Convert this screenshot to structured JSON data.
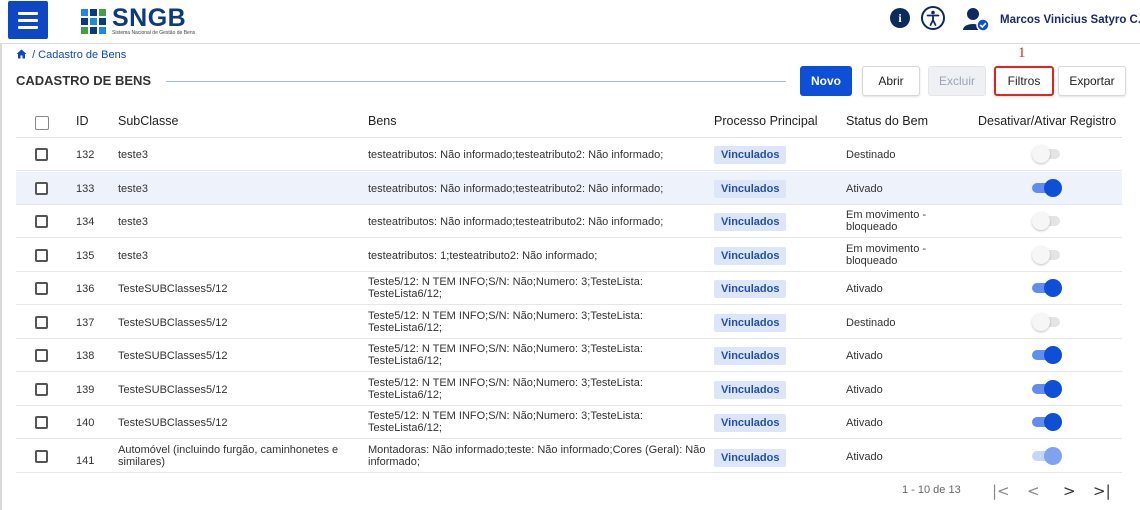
{
  "app": {
    "logo_text": "SNGB",
    "logo_subtitle": "Sistema Nacional de Gestão de Bens",
    "user_name": "Marcos Vinicius Satyro C..."
  },
  "breadcrumb": {
    "text": "/ Cadastro de Bens"
  },
  "page": {
    "title": "CADASTRO DE BENS"
  },
  "toolbar": {
    "novo": "Novo",
    "abrir": "Abrir",
    "excluir": "Excluir",
    "filtros": "Filtros",
    "exportar": "Exportar",
    "marker": "1"
  },
  "table": {
    "headers": {
      "id": "ID",
      "subclasse": "SubClasse",
      "bens": "Bens",
      "processo": "Processo Principal",
      "status": "Status do Bem",
      "toggle": "Desativar/Ativar Registro"
    },
    "rows": [
      {
        "id": "132",
        "subclasse": "teste3",
        "bens": "testeatributos: Não informado;testeatributo2: Não informado;",
        "processo": "Vinculados",
        "status": "Destinado",
        "active": false
      },
      {
        "id": "133",
        "subclasse": "teste3",
        "bens": "testeatributos: Não informado;testeatributo2: Não informado;",
        "processo": "Vinculados",
        "status": "Ativado",
        "active": true
      },
      {
        "id": "134",
        "subclasse": "teste3",
        "bens": "testeatributos: Não informado;testeatributo2: Não informado;",
        "processo": "Vinculados",
        "status": "Em movimento - bloqueado",
        "active": false
      },
      {
        "id": "135",
        "subclasse": "teste3",
        "bens": "testeatributos: 1;testeatributo2: Não informado;",
        "processo": "Vinculados",
        "status": "Em movimento - bloqueado",
        "active": false
      },
      {
        "id": "136",
        "subclasse": "TesteSUBClasses5/12",
        "bens": "Teste5/12: N TEM INFO;S/N: Não;Numero: 3;TesteLista: TesteLista6/12;",
        "processo": "Vinculados",
        "status": "Ativado",
        "active": true
      },
      {
        "id": "137",
        "subclasse": "TesteSUBClasses5/12",
        "bens": "Teste5/12: N TEM INFO;S/N: Não;Numero: 3;TesteLista: TesteLista6/12;",
        "processo": "Vinculados",
        "status": "Destinado",
        "active": false
      },
      {
        "id": "138",
        "subclasse": "TesteSUBClasses5/12",
        "bens": "Teste5/12: N TEM INFO;S/N: Não;Numero: 3;TesteLista: TesteLista6/12;",
        "processo": "Vinculados",
        "status": "Ativado",
        "active": true
      },
      {
        "id": "139",
        "subclasse": "TesteSUBClasses5/12",
        "bens": "Teste5/12: N TEM INFO;S/N: Não;Numero: 3;TesteLista: TesteLista6/12;",
        "processo": "Vinculados",
        "status": "Ativado",
        "active": true
      },
      {
        "id": "140",
        "subclasse": "TesteSUBClasses5/12",
        "bens": "Teste5/12: N TEM INFO;S/N: Não;Numero: 3;TesteLista: TesteLista6/12;",
        "processo": "Vinculados",
        "status": "Ativado",
        "active": true
      },
      {
        "id": "141",
        "subclasse": "Automóvel (incluindo furgão, caminhonetes e similares)",
        "bens": "Montadoras: Não informado;teste: Não informado;Cores (Geral): Não informado;",
        "processo": "Vinculados",
        "status": "Ativado",
        "active": true
      }
    ]
  },
  "pagination": {
    "range": "1 - 10 de 13",
    "first": "|<",
    "prev": "<",
    "next": ">",
    "last": ">|"
  },
  "colors": {
    "primary": "#0d4fd6",
    "highlight": "#e52222",
    "badge_bg": "#dde6f8"
  }
}
